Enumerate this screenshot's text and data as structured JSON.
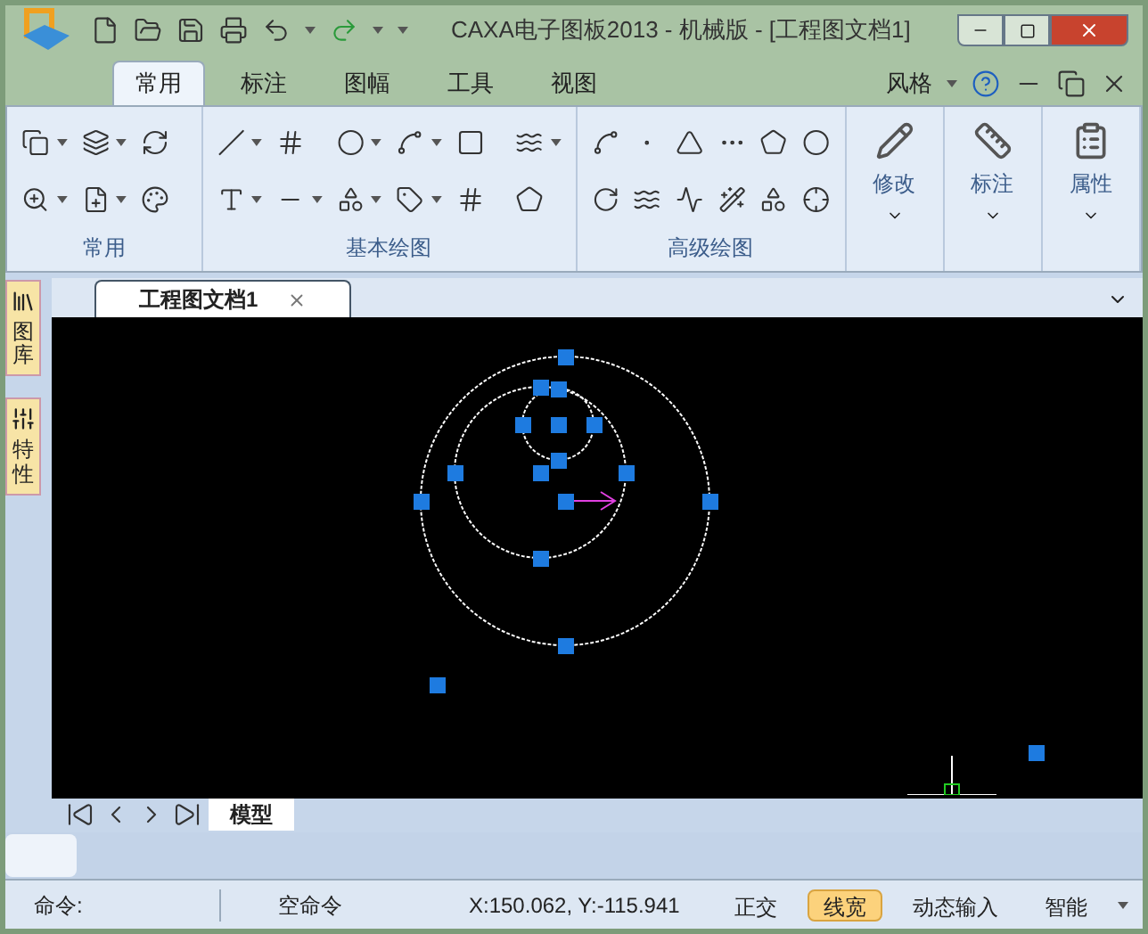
{
  "window": {
    "title": "CAXA电子图板2013 - 机械版 - [工程图文档1]"
  },
  "ribbon_tabs": [
    {
      "label": "常用",
      "selected": true
    },
    {
      "label": "标注",
      "selected": false
    },
    {
      "label": "图幅",
      "selected": false
    },
    {
      "label": "工具",
      "selected": false
    },
    {
      "label": "视图",
      "selected": false
    }
  ],
  "style_menu": {
    "label": "风格"
  },
  "ribbon_groups": [
    {
      "label": "常用"
    },
    {
      "label": "基本绘图"
    },
    {
      "label": "高级绘图"
    }
  ],
  "big_buttons": [
    {
      "label": "修改"
    },
    {
      "label": "标注"
    },
    {
      "label": "属性"
    }
  ],
  "side_panels": [
    {
      "label": "图库"
    },
    {
      "label": "特性"
    }
  ],
  "document_tab": {
    "label": "工程图文档1"
  },
  "layout_tab": {
    "label": "模型",
    "selected": true
  },
  "status_bar": {
    "command_label": "命令:",
    "command_state": "空命令",
    "coordinates": "X:150.062, Y:-115.941",
    "toggles": [
      {
        "label": "正交",
        "on": false
      },
      {
        "label": "线宽",
        "on": true
      },
      {
        "label": "动态输入",
        "on": false
      },
      {
        "label": "智能",
        "on": false
      }
    ]
  }
}
